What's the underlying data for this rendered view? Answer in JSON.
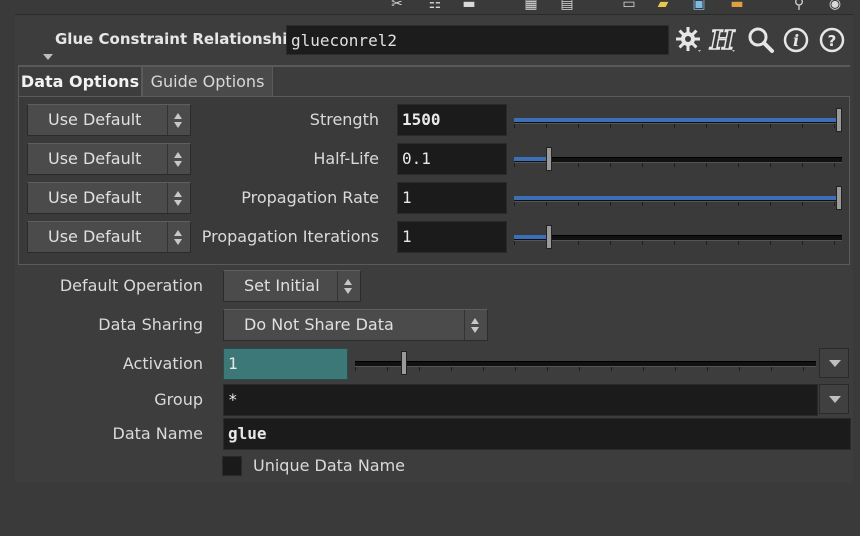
{
  "header": {
    "title": "Glue Constraint Relationship",
    "node_name": "glueconrel2",
    "icons": [
      "gear-icon",
      "houdini-help-icon",
      "search-icon",
      "info-icon",
      "help-icon"
    ]
  },
  "tabs": [
    {
      "label": "Data Options",
      "active": true
    },
    {
      "label": "Guide Options",
      "active": false
    }
  ],
  "data_options": [
    {
      "mode": "Use Default",
      "label": "Strength",
      "value": "1500",
      "bold": true,
      "level": 1.0
    },
    {
      "mode": "Use Default",
      "label": "Half-Life",
      "value": "0.1",
      "bold": false,
      "level": 0.1
    },
    {
      "mode": "Use Default",
      "label": "Propagation Rate",
      "value": "1",
      "bold": false,
      "level": 1.0
    },
    {
      "mode": "Use Default",
      "label": "Propagation Iterations",
      "value": "1",
      "bold": false,
      "level": 0.1
    }
  ],
  "default_operation": {
    "label": "Default Operation",
    "value": "Set Initial"
  },
  "data_sharing": {
    "label": "Data Sharing",
    "value": "Do Not Share Data"
  },
  "activation": {
    "label": "Activation",
    "value": "1",
    "level": 0.1
  },
  "group": {
    "label": "Group",
    "value": "*"
  },
  "data_name": {
    "label": "Data Name",
    "value": "glue"
  },
  "unique_data_name": {
    "label": "Unique Data Name",
    "checked": false
  },
  "colors": {
    "accent": "#3d6fb8",
    "activation_field": "#3d7878"
  }
}
